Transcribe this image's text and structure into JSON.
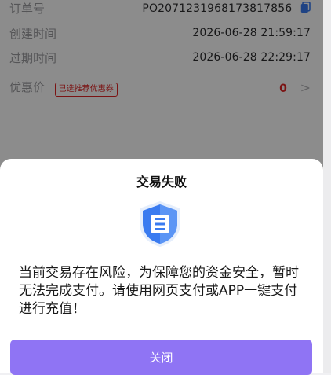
{
  "order": {
    "order_no_label": "订单号",
    "order_no": "PO2071231968173817856",
    "created_label": "创建时间",
    "created": "2026-06-28 21:59:17",
    "expire_label": "过期时间",
    "expire": "2026-06-28 22:29:17",
    "discount_label": "优惠价",
    "coupon_badge": "已选推荐优惠券",
    "discount_value": "0",
    "chevron": ">"
  },
  "modal": {
    "title": "交易失败",
    "message": "当前交易存在风险，为保障您的资金安全，暂时无法完成支付。请使用网页支付或APP一键支付进行充值！",
    "close_label": "关闭",
    "icon": "shield-icon"
  },
  "colors": {
    "accent": "#8f74f4",
    "danger": "#e02424",
    "shield_blue": "#3a7bf0"
  }
}
